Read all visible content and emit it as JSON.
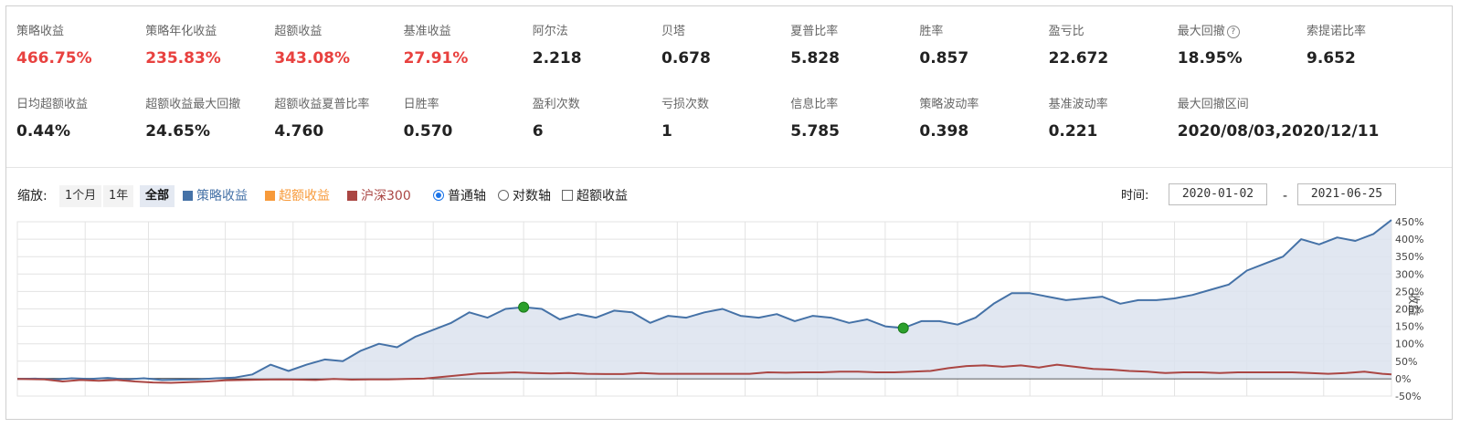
{
  "stats": [
    {
      "label": "策略收益",
      "value": "466.75%",
      "red": true
    },
    {
      "label": "策略年化收益",
      "value": "235.83%",
      "red": true
    },
    {
      "label": "超额收益",
      "value": "343.08%",
      "red": true
    },
    {
      "label": "基准收益",
      "value": "27.91%",
      "red": true
    },
    {
      "label": "阿尔法",
      "value": "2.218",
      "red": false
    },
    {
      "label": "贝塔",
      "value": "0.678",
      "red": false
    },
    {
      "label": "夏普比率",
      "value": "5.828",
      "red": false
    },
    {
      "label": "胜率",
      "value": "0.857",
      "red": false
    },
    {
      "label": "盈亏比",
      "value": "22.672",
      "red": false
    },
    {
      "label": "最大回撤",
      "value": "18.95%",
      "red": false,
      "help": "?"
    },
    {
      "label": "索提诺比率",
      "value": "9.652",
      "red": false
    },
    {
      "label": "日均超额收益",
      "value": "0.44%",
      "red": false
    },
    {
      "label": "超额收益最大回撤",
      "value": "24.65%",
      "red": false
    },
    {
      "label": "超额收益夏普比率",
      "value": "4.760",
      "red": false
    },
    {
      "label": "日胜率",
      "value": "0.570",
      "red": false
    },
    {
      "label": "盈利次数",
      "value": "6",
      "red": false
    },
    {
      "label": "亏损次数",
      "value": "1",
      "red": false
    },
    {
      "label": "信息比率",
      "value": "5.785",
      "red": false
    },
    {
      "label": "策略波动率",
      "value": "0.398",
      "red": false
    },
    {
      "label": "基准波动率",
      "value": "0.221",
      "red": false
    },
    {
      "label": "最大回撤区间",
      "value": "2020/08/03,2020/12/11",
      "red": false
    }
  ],
  "controls": {
    "zoom_label": "缩放:",
    "zoom_buttons": [
      "1个月",
      "1年",
      "全部"
    ],
    "zoom_active": "全部",
    "legend": [
      {
        "name": "策略收益",
        "color": "#4572a7"
      },
      {
        "name": "超额收益",
        "color": "#f79a3a"
      },
      {
        "name": "沪深300",
        "color": "#aa4643"
      }
    ],
    "axis_normal": "普通轴",
    "axis_log": "对数轴",
    "excess_checkbox": "超额收益",
    "time_label": "时间:",
    "date_start": "2020-01-02",
    "date_sep": "-",
    "date_end": "2021-06-25"
  },
  "chart_data": {
    "type": "line",
    "ylabel": "收益",
    "ylim": [
      -50,
      450
    ],
    "y_ticks": [
      "450%",
      "400%",
      "350%",
      "300%",
      "250%",
      "200%",
      "150%",
      "100%",
      "50%",
      "0%",
      "-50%"
    ],
    "x_range": [
      "2020-01-02",
      "2021-06-25"
    ],
    "series": [
      {
        "name": "策略收益",
        "color": "#4572a7",
        "area": true,
        "points": [
          [
            0,
            -1
          ],
          [
            4,
            0
          ],
          [
            8,
            -3
          ],
          [
            12,
            1
          ],
          [
            16,
            -1
          ],
          [
            20,
            2
          ],
          [
            24,
            -2
          ],
          [
            28,
            1
          ],
          [
            32,
            -4
          ],
          [
            36,
            -3
          ],
          [
            40,
            -2
          ],
          [
            44,
            1
          ],
          [
            48,
            3
          ],
          [
            52,
            12
          ],
          [
            56,
            40
          ],
          [
            60,
            22
          ],
          [
            64,
            40
          ],
          [
            68,
            55
          ],
          [
            72,
            50
          ],
          [
            76,
            80
          ],
          [
            80,
            100
          ],
          [
            84,
            90
          ],
          [
            88,
            120
          ],
          [
            92,
            140
          ],
          [
            96,
            160
          ],
          [
            100,
            190
          ],
          [
            104,
            175
          ],
          [
            108,
            200
          ],
          [
            112,
            205
          ],
          [
            116,
            200
          ],
          [
            120,
            170
          ],
          [
            124,
            185
          ],
          [
            128,
            175
          ],
          [
            132,
            195
          ],
          [
            136,
            190
          ],
          [
            140,
            160
          ],
          [
            144,
            180
          ],
          [
            148,
            175
          ],
          [
            152,
            190
          ],
          [
            156,
            200
          ],
          [
            160,
            180
          ],
          [
            164,
            175
          ],
          [
            168,
            185
          ],
          [
            172,
            165
          ],
          [
            176,
            180
          ],
          [
            180,
            175
          ],
          [
            184,
            160
          ],
          [
            188,
            170
          ],
          [
            192,
            150
          ],
          [
            196,
            145
          ],
          [
            200,
            165
          ],
          [
            204,
            165
          ],
          [
            208,
            155
          ],
          [
            212,
            175
          ],
          [
            216,
            215
          ],
          [
            220,
            245
          ],
          [
            224,
            245
          ],
          [
            228,
            235
          ],
          [
            232,
            225
          ],
          [
            236,
            230
          ],
          [
            240,
            235
          ],
          [
            244,
            215
          ],
          [
            248,
            225
          ],
          [
            252,
            225
          ],
          [
            256,
            230
          ],
          [
            260,
            240
          ],
          [
            264,
            255
          ],
          [
            268,
            270
          ],
          [
            272,
            310
          ],
          [
            276,
            330
          ],
          [
            280,
            350
          ],
          [
            284,
            400
          ],
          [
            288,
            385
          ],
          [
            292,
            405
          ],
          [
            296,
            395
          ],
          [
            300,
            415
          ],
          [
            304,
            455
          ]
        ]
      },
      {
        "name": "沪深300",
        "color": "#aa4643",
        "area": false,
        "points": [
          [
            0,
            -1
          ],
          [
            6,
            -2
          ],
          [
            10,
            -8
          ],
          [
            14,
            -4
          ],
          [
            18,
            -6
          ],
          [
            22,
            -4
          ],
          [
            26,
            -8
          ],
          [
            30,
            -11
          ],
          [
            34,
            -12
          ],
          [
            38,
            -10
          ],
          [
            42,
            -8
          ],
          [
            46,
            -5
          ],
          [
            50,
            -4
          ],
          [
            54,
            -3
          ],
          [
            58,
            -2
          ],
          [
            62,
            -3
          ],
          [
            66,
            -4
          ],
          [
            70,
            -1
          ],
          [
            74,
            -3
          ],
          [
            78,
            -2
          ],
          [
            82,
            -2
          ],
          [
            86,
            -1
          ],
          [
            90,
            0
          ],
          [
            94,
            5
          ],
          [
            98,
            10
          ],
          [
            102,
            15
          ],
          [
            106,
            16
          ],
          [
            110,
            18
          ],
          [
            114,
            16
          ],
          [
            118,
            15
          ],
          [
            122,
            16
          ],
          [
            126,
            14
          ],
          [
            130,
            13
          ],
          [
            134,
            13
          ],
          [
            138,
            16
          ],
          [
            142,
            14
          ],
          [
            146,
            14
          ],
          [
            150,
            14
          ],
          [
            154,
            14
          ],
          [
            158,
            14
          ],
          [
            162,
            14
          ],
          [
            166,
            18
          ],
          [
            170,
            17
          ],
          [
            174,
            18
          ],
          [
            178,
            18
          ],
          [
            182,
            20
          ],
          [
            186,
            20
          ],
          [
            190,
            18
          ],
          [
            194,
            18
          ],
          [
            198,
            20
          ],
          [
            202,
            22
          ],
          [
            206,
            30
          ],
          [
            210,
            36
          ],
          [
            214,
            38
          ],
          [
            218,
            34
          ],
          [
            222,
            38
          ],
          [
            226,
            32
          ],
          [
            230,
            40
          ],
          [
            234,
            34
          ],
          [
            238,
            28
          ],
          [
            242,
            26
          ],
          [
            246,
            22
          ],
          [
            250,
            20
          ],
          [
            254,
            16
          ],
          [
            258,
            18
          ],
          [
            262,
            18
          ],
          [
            266,
            16
          ],
          [
            270,
            18
          ],
          [
            274,
            18
          ],
          [
            278,
            18
          ],
          [
            282,
            18
          ],
          [
            286,
            16
          ],
          [
            290,
            14
          ],
          [
            294,
            16
          ],
          [
            298,
            20
          ],
          [
            302,
            14
          ],
          [
            304,
            12
          ]
        ]
      }
    ],
    "markers": [
      [
        112,
        205
      ],
      [
        196,
        145
      ]
    ],
    "marker_color": "#2ca02c"
  }
}
